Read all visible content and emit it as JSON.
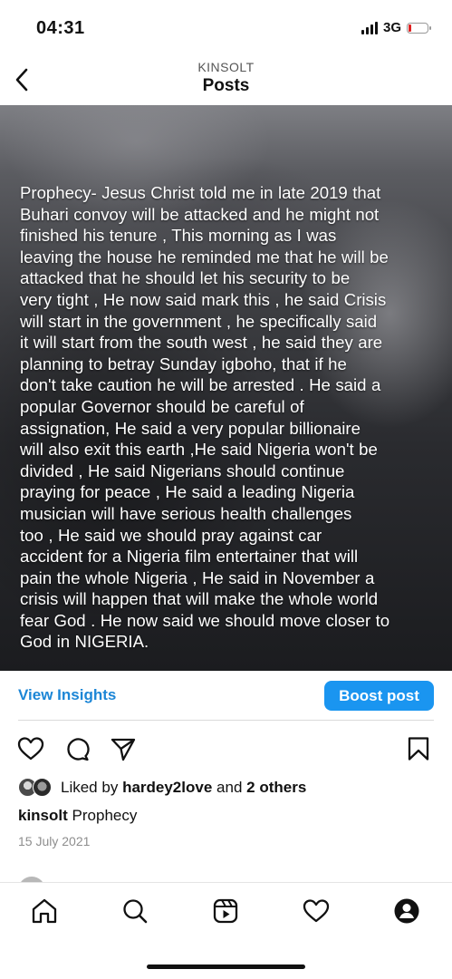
{
  "status_bar": {
    "time": "04:31",
    "network": "3G"
  },
  "header": {
    "username": "KINSOLT",
    "title": "Posts"
  },
  "post": {
    "text": "Prophecy- Jesus Christ told me in late 2019 that\nBuhari convoy will be attacked and he might not\nfinished his tenure , This morning as I was\nleaving the house he reminded me that he will be\nattacked that he should let his security to be\nvery tight , He now said mark this , he said Crisis\nwill start in the government , he specifically said\nit will start from the south west , he said they are\nplanning to betray Sunday igboho,  that if he\ndon't take caution he will be arrested .  He said a\npopular Governor should be careful of\nassignation, He said a very popular billionaire\nwill also exit this earth ,He said Nigeria won't be\ndivided , He said Nigerians should continue\npraying for peace , He said a leading Nigeria\nmusician will have serious health challenges\ntoo ,  He said we should pray against car\naccident for a Nigeria film entertainer that will\npain the whole Nigeria , He said in November a\ncrisis will happen that will make the whole world\nfear God . He now said we should move closer to\nGod in NIGERIA."
  },
  "insights": {
    "view_label": "View Insights",
    "boost_label": "Boost post"
  },
  "actions": {
    "icons": [
      "heart-icon",
      "comment-icon",
      "share-icon",
      "bookmark-icon"
    ]
  },
  "likes": {
    "prefix": "Liked by",
    "user": "hardey2love",
    "joiner": "and",
    "others": "2 others"
  },
  "caption": {
    "username": "kinsolt",
    "text": "Prophecy"
  },
  "date": "15 July 2021",
  "tab_bar": {
    "icons": [
      "home-icon",
      "search-icon",
      "reels-icon",
      "activity-icon",
      "profile-icon"
    ]
  },
  "colors": {
    "accent": "#1a95f0",
    "link": "#1c86d6",
    "battery_low": "#e02020"
  }
}
